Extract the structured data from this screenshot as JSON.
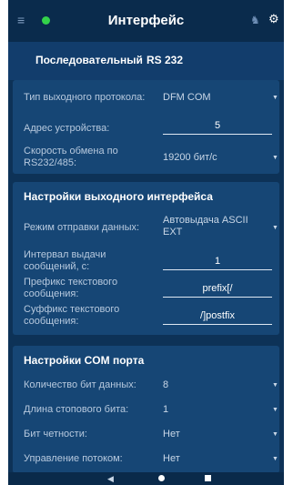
{
  "header": {
    "title": "Интерфейс",
    "icons": {
      "menu": "menu-icon",
      "status_dot": "status-dot",
      "user": "user-icon",
      "settings": "gear-icon"
    },
    "colors": {
      "status": "#33d24a",
      "background": "#0a2b4c"
    }
  },
  "tabs": [
    {
      "label": "Последовательный"
    },
    {
      "label": "RS 232"
    }
  ],
  "protocol": {
    "rows": [
      {
        "label": "Тип выходного протокола:",
        "value": "DFM COM",
        "control": "dropdown"
      },
      {
        "label": "Адрес устройства:",
        "value": "5",
        "control": "input"
      },
      {
        "label": "Скорость обмена по RS232/485:",
        "value": "19200 бит/с",
        "control": "dropdown"
      }
    ]
  },
  "output_interface": {
    "title": "Настройки выходного интерфейса",
    "rows": [
      {
        "label": "Режим отправки данных:",
        "value": "Автовыдача ASCII EXT",
        "control": "dropdown"
      },
      {
        "label": "Интервал выдачи сообщений, с:",
        "value": "1",
        "control": "input"
      },
      {
        "label": "Префикс текстового сообщения:",
        "value": "prefix[/",
        "control": "input"
      },
      {
        "label": "Суффикс текстового сообщения:",
        "value": "/]postfix",
        "control": "input"
      }
    ]
  },
  "com_port": {
    "title": "Настройки COM порта",
    "rows": [
      {
        "label": "Количество бит данных:",
        "value": "8",
        "control": "dropdown"
      },
      {
        "label": "Длина стопового бита:",
        "value": "1",
        "control": "dropdown"
      },
      {
        "label": "Бит четности:",
        "value": "Нет",
        "control": "dropdown"
      },
      {
        "label": "Управление потоком:",
        "value": "Нет",
        "control": "dropdown"
      }
    ]
  },
  "navbar": {
    "icons": [
      "back-icon",
      "home-icon",
      "recent-apps-icon"
    ]
  }
}
